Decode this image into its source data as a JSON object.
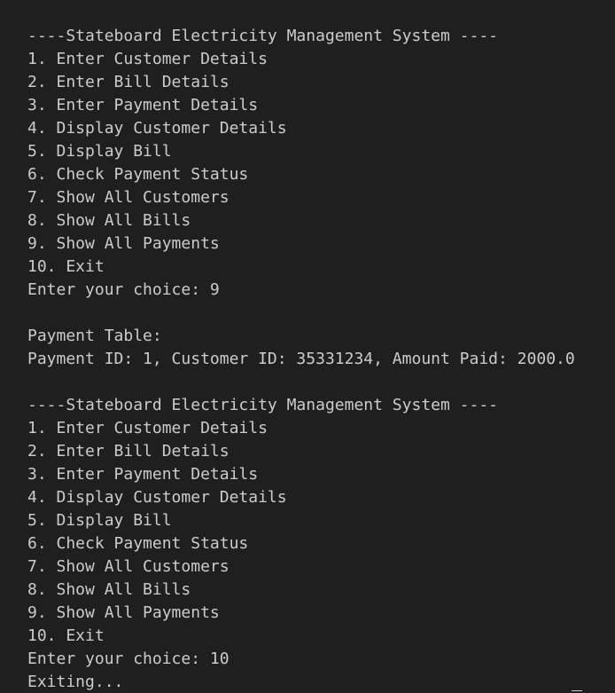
{
  "terminal": {
    "block1": {
      "header": "----Stateboard Electricity Management System ----",
      "menu": [
        "1. Enter Customer Details",
        "2. Enter Bill Details",
        "3. Enter Payment Details",
        "4. Display Customer Details",
        "5. Display Bill",
        "6. Check Payment Status",
        "7. Show All Customers",
        "8. Show All Bills",
        "9. Show All Payments",
        "10. Exit"
      ],
      "prompt": "Enter your choice: 9"
    },
    "payment_table": {
      "title": "Payment Table:",
      "rows": [
        "Payment ID: 1, Customer ID: 35331234, Amount Paid: 2000.0"
      ]
    },
    "block2": {
      "header": "----Stateboard Electricity Management System ----",
      "menu": [
        "1. Enter Customer Details",
        "2. Enter Bill Details",
        "3. Enter Payment Details",
        "4. Display Customer Details",
        "5. Display Bill",
        "6. Check Payment Status",
        "7. Show All Customers",
        "8. Show All Bills",
        "9. Show All Payments",
        "10. Exit"
      ],
      "prompt": "Enter your choice: 10",
      "exit_message": "Exiting..."
    }
  },
  "colors": {
    "background": "#1f1f1f",
    "text": "#cccccc"
  }
}
